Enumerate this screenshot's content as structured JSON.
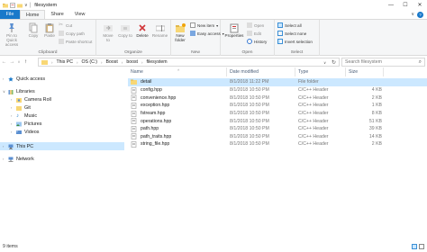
{
  "window": {
    "title": "filesystem",
    "controls": {
      "minimize": "—",
      "maximize": "☐",
      "close": "✕"
    }
  },
  "ribbon_tabs": [
    "File",
    "Home",
    "Share",
    "View"
  ],
  "ribbon": {
    "clipboard": {
      "pin_to_quick_access": "Pin to Quick access",
      "copy": "Copy",
      "paste": "Paste",
      "cut": "Cut",
      "copy_path": "Copy path",
      "paste_shortcut": "Paste shortcut",
      "label": "Clipboard"
    },
    "organize": {
      "move_to": "Move to",
      "copy_to": "Copy to",
      "delete": "Delete",
      "rename": "Rename",
      "label": "Organize"
    },
    "new": {
      "new_folder": "New folder",
      "new_item": "New item",
      "easy_access": "Easy access",
      "label": "New"
    },
    "open": {
      "properties": "Properties",
      "open": "Open",
      "edit": "Edit",
      "history": "History",
      "label": "Open"
    },
    "select": {
      "select_all": "Select all",
      "select_none": "Select none",
      "invert_selection": "Invert selection",
      "label": "Select"
    }
  },
  "address": {
    "crumbs": [
      "This PC",
      "OS (C:)",
      "Boost",
      "boost",
      "filesystem"
    ],
    "search_placeholder": "Search filesystem"
  },
  "nav_pane": {
    "items": [
      {
        "label": "Quick access",
        "icon": "star-icon",
        "indent": 0
      },
      {
        "label": "Libraries",
        "icon": "library-icon",
        "indent": 0
      },
      {
        "label": "Camera Roll",
        "icon": "camera-roll-icon",
        "indent": 1
      },
      {
        "label": "Git",
        "icon": "git-folder-icon",
        "indent": 1
      },
      {
        "label": "Music",
        "icon": "music-icon",
        "indent": 1
      },
      {
        "label": "Pictures",
        "icon": "pictures-icon",
        "indent": 1
      },
      {
        "label": "Videos",
        "icon": "videos-icon",
        "indent": 1
      },
      {
        "label": "This PC",
        "icon": "computer-icon",
        "indent": 0,
        "selected": true
      },
      {
        "label": "Network",
        "icon": "network-icon",
        "indent": 0
      }
    ]
  },
  "file_list": {
    "columns": [
      "Name",
      "Date modified",
      "Type",
      "Size"
    ],
    "rows": [
      {
        "name": "detail",
        "date": "8/1/2018 11:22 PM",
        "type": "File folder",
        "size": "",
        "icon": "folder-icon",
        "selected": true
      },
      {
        "name": "config.hpp",
        "date": "8/1/2018 10:50 PM",
        "type": "C/C++ Header",
        "size": "4 KB",
        "icon": "header-file-icon"
      },
      {
        "name": "convenience.hpp",
        "date": "8/1/2018 10:50 PM",
        "type": "C/C++ Header",
        "size": "2 KB",
        "icon": "header-file-icon"
      },
      {
        "name": "exception.hpp",
        "date": "8/1/2018 10:50 PM",
        "type": "C/C++ Header",
        "size": "1 KB",
        "icon": "header-file-icon"
      },
      {
        "name": "fstream.hpp",
        "date": "8/1/2018 10:50 PM",
        "type": "C/C++ Header",
        "size": "8 KB",
        "icon": "header-file-icon"
      },
      {
        "name": "operations.hpp",
        "date": "8/1/2018 10:50 PM",
        "type": "C/C++ Header",
        "size": "51 KB",
        "icon": "header-file-icon"
      },
      {
        "name": "path.hpp",
        "date": "8/1/2018 10:50 PM",
        "type": "C/C++ Header",
        "size": "39 KB",
        "icon": "header-file-icon"
      },
      {
        "name": "path_traits.hpp",
        "date": "8/1/2018 10:50 PM",
        "type": "C/C++ Header",
        "size": "14 KB",
        "icon": "header-file-icon"
      },
      {
        "name": "string_file.hpp",
        "date": "8/1/2018 10:50 PM",
        "type": "C/C++ Header",
        "size": "2 KB",
        "icon": "header-file-icon"
      }
    ]
  },
  "status": {
    "item_count": "9 items"
  },
  "colors": {
    "accent": "#1979ca",
    "selection": "#cce8ff",
    "folder": "#f8d775"
  }
}
